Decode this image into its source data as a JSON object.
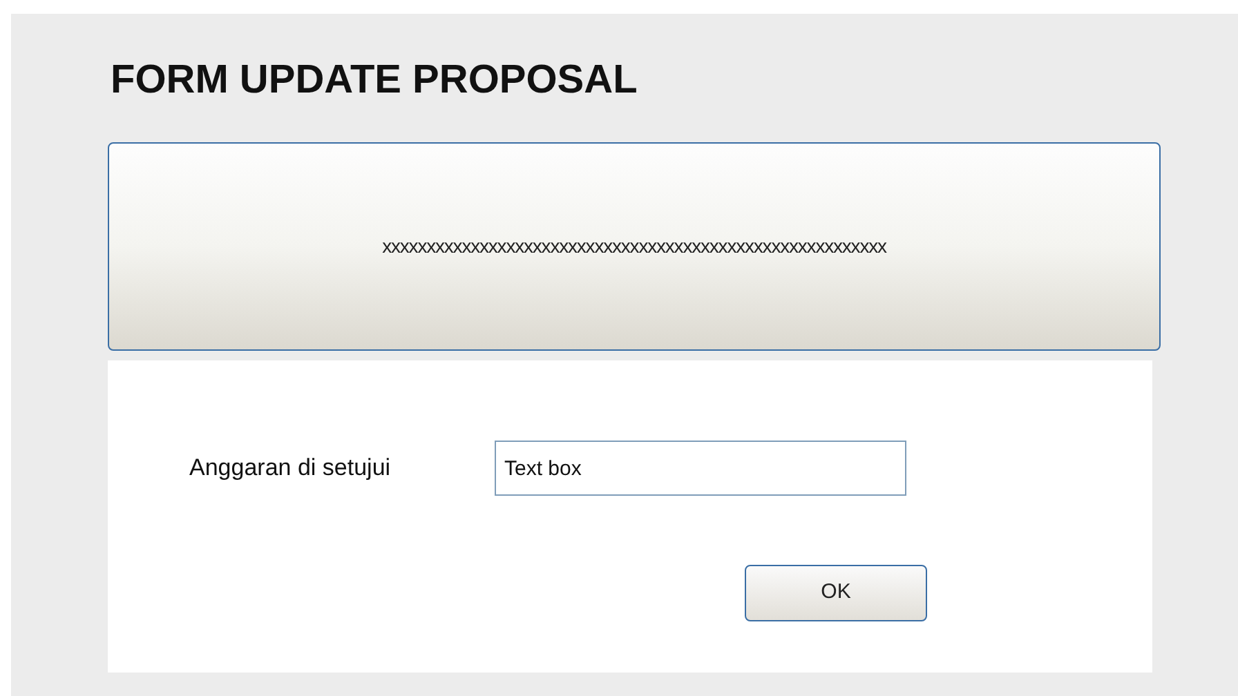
{
  "title": "FORM UPDATE PROPOSAL",
  "banner": {
    "text": "xxxxxxxxxxxxxxxxxxxxxxxxxxxxxxxxxxxxxxxxxxxxxxxxxxxxxxxxx"
  },
  "form": {
    "label": "Anggaran di setujui",
    "value": "Text box",
    "button": "OK"
  }
}
